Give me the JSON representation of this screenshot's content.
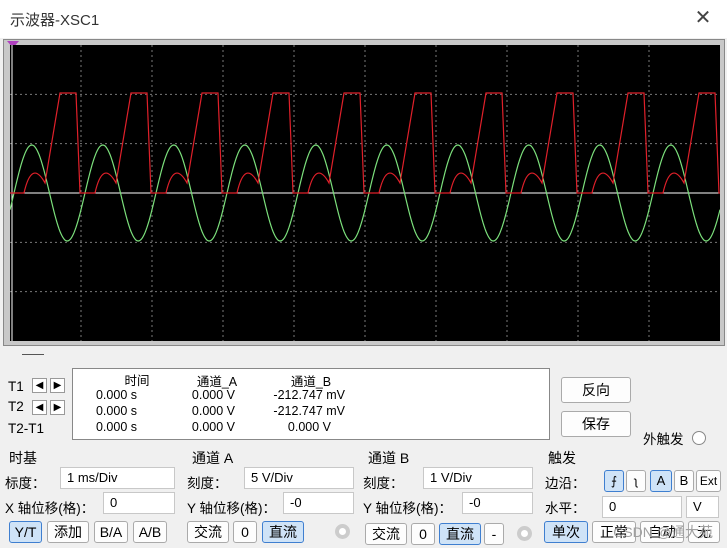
{
  "window": {
    "title": "示波器-XSC1",
    "close_glyph": "✕"
  },
  "scope": {
    "grid_color": "#7a7a7a",
    "channel_a_color": "#e0202a",
    "channel_b_color": "#7ce07c",
    "center_line_color": "#ffffff"
  },
  "cursors": {
    "t1": "T1",
    "t2": "T2",
    "t2_t1": "T2-T1",
    "left_arrow": "◀",
    "right_arrow": "▶"
  },
  "readout": {
    "headers": {
      "time": "时间",
      "ch_a": "通道_A",
      "ch_b": "通道_B"
    },
    "rows": [
      {
        "time": "0.000 s",
        "ch_a": "0.000 V",
        "ch_b": "-212.747 mV"
      },
      {
        "time": "0.000 s",
        "ch_a": "0.000 V",
        "ch_b": "-212.747 mV"
      },
      {
        "time": "0.000 s",
        "ch_a": "0.000 V",
        "ch_b": "0.000 V"
      }
    ]
  },
  "actions": {
    "reverse": "反向",
    "save": "保存",
    "ext_trigger": "外触发"
  },
  "timebase": {
    "title": "时基",
    "scale_label": "标度：",
    "scale_value": "1 ms/Div",
    "xpos_label": "X 轴位移(格)：",
    "xpos_value": "0",
    "modes": [
      "Y/T",
      "添加",
      "B/A",
      "A/B"
    ]
  },
  "channel_a": {
    "title": "通道 A",
    "scale_label": "刻度：",
    "scale_value": "5  V/Div",
    "ypos_label": "Y 轴位移(格)：",
    "ypos_value": "-0",
    "coupling": [
      "交流",
      "0",
      "直流"
    ]
  },
  "channel_b": {
    "title": "通道 B",
    "scale_label": "刻度：",
    "scale_value": "1  V/Div",
    "ypos_label": "Y 轴位移(格)：",
    "ypos_value": "-0",
    "coupling": [
      "交流",
      "0",
      "直流",
      "-"
    ]
  },
  "trigger": {
    "title": "触发",
    "edge_label": "边沿：",
    "edge_rise": "⨍",
    "edge_fall": "ʅ",
    "sources": [
      "A",
      "B",
      "Ext"
    ],
    "level_label": "水平：",
    "level_value": "0",
    "level_unit": "V",
    "modes": [
      "单次",
      "正常",
      "自动",
      "无"
    ]
  },
  "watermark": "CSDN @通大苑"
}
